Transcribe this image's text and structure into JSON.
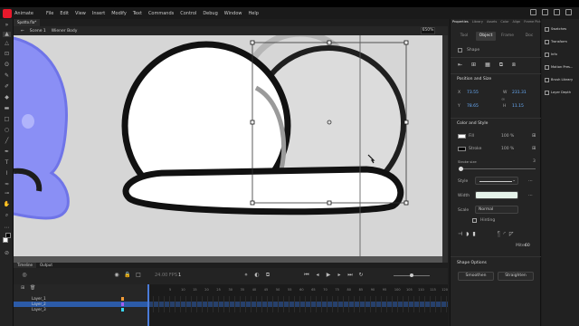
{
  "app": {
    "name": "Animate"
  },
  "menu": [
    "File",
    "Edit",
    "View",
    "Insert",
    "Modify",
    "Text",
    "Commands",
    "Control",
    "Debug",
    "Window",
    "Help"
  ],
  "document_tab": {
    "label": "Spotto.fla*"
  },
  "breadcrumb": {
    "scene": "Scene 1",
    "symbol": "Wiener Body"
  },
  "zoom": "650%",
  "timeline": {
    "tabs": [
      "Timeline",
      "Output"
    ],
    "fps": "24.00",
    "fps_unit": "FPS",
    "frame": "1",
    "layers": [
      {
        "name": "Layer_1",
        "color": "#f29c38",
        "selected": false
      },
      {
        "name": "Layer_2",
        "color": "#a15cf2",
        "selected": true
      },
      {
        "name": "Layer_3",
        "color": "#3ad7f2",
        "selected": false
      }
    ],
    "ruler": [
      "5",
      "10",
      "15",
      "20",
      "25",
      "30",
      "35",
      "40",
      "45",
      "50",
      "55",
      "60",
      "65",
      "70",
      "75",
      "80",
      "85",
      "90",
      "95",
      "100",
      "105",
      "110",
      "115",
      "120"
    ]
  },
  "properties": {
    "tabs": [
      "Properties",
      "Library",
      "Assets",
      "Color",
      "Align",
      "Frame Pict"
    ],
    "subtabs": [
      "Tool",
      "Object",
      "Frame",
      "Doc"
    ],
    "object_type": "Shape",
    "position_size": {
      "title": "Position and Size",
      "x_label": "X",
      "x": "73.55",
      "y_label": "Y",
      "y": "78.65",
      "w_label": "W",
      "w": "231.31",
      "h_label": "H",
      "h": "11.15"
    },
    "color_style": {
      "title": "Color and Style",
      "fill_label": "Fill",
      "fill_percent": "100 %",
      "stroke_label": "Stroke",
      "stroke_percent": "100 %",
      "stroke_size_label": "Stroke size",
      "stroke_size": "3",
      "style_label": "Style",
      "width_label": "Width",
      "scale_label": "Scale",
      "scale_value": "Normal",
      "hinting_label": "Hinting",
      "miter_label": "Miter",
      "miter": "60"
    },
    "shape_options": {
      "title": "Shape Options",
      "smoothen": "Smoothen",
      "straighten": "Straighten"
    }
  },
  "dock": [
    "Swatches",
    "Transform",
    "Info",
    "Motion Pres...",
    "Brush Library",
    "Layer Depth"
  ],
  "colors": {
    "accent": "#2c5ba8",
    "stage": "#d6d6d6",
    "ghost_shape": "#8a8ff5"
  }
}
